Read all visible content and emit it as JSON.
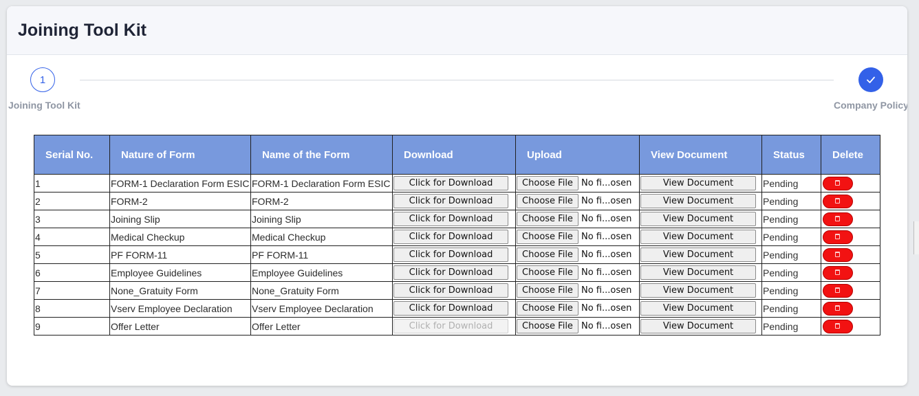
{
  "page": {
    "title": "Joining Tool Kit"
  },
  "stepper": {
    "steps": [
      {
        "number": "1",
        "label": "Joining Tool Kit"
      },
      {
        "number": "",
        "label": "Company Policy",
        "icon": "check-icon"
      }
    ]
  },
  "table": {
    "headers": [
      "Serial No.",
      "Nature of Form",
      "Name of the Form",
      "Download",
      "Upload",
      "View Document",
      "Status",
      "Delete"
    ],
    "download_label": "Click for Download",
    "choose_file_label": "Choose File",
    "no_file_label": "No fi...osen",
    "view_label": "View Document",
    "delete_icon": "trash-icon",
    "rows": [
      {
        "serial": "1",
        "nature": "FORM-1 Declaration Form ESIC",
        "name": "FORM-1 Declaration Form ESIC",
        "status": "Pending",
        "download_enabled": true
      },
      {
        "serial": "2",
        "nature": "FORM-2",
        "name": "FORM-2",
        "status": "Pending",
        "download_enabled": true
      },
      {
        "serial": "3",
        "nature": "Joining Slip",
        "name": "Joining Slip",
        "status": "Pending",
        "download_enabled": true
      },
      {
        "serial": "4",
        "nature": "Medical Checkup",
        "name": "Medical Checkup",
        "status": "Pending",
        "download_enabled": true
      },
      {
        "serial": "5",
        "nature": "PF FORM-11",
        "name": "PF FORM-11",
        "status": "Pending",
        "download_enabled": true
      },
      {
        "serial": "6",
        "nature": "Employee Guidelines",
        "name": "Employee Guidelines",
        "status": "Pending",
        "download_enabled": true
      },
      {
        "serial": "7",
        "nature": "None_Gratuity Form",
        "name": "None_Gratuity Form",
        "status": "Pending",
        "download_enabled": true
      },
      {
        "serial": "8",
        "nature": "Vserv Employee Declaration",
        "name": "Vserv Employee Declaration",
        "status": "Pending",
        "download_enabled": true
      },
      {
        "serial": "9",
        "nature": "Offer Letter",
        "name": "Offer Letter",
        "status": "Pending",
        "download_enabled": false
      }
    ]
  },
  "colors": {
    "accent": "#3361e8",
    "header_bg": "#7899dd",
    "delete_red": "#f21212"
  }
}
